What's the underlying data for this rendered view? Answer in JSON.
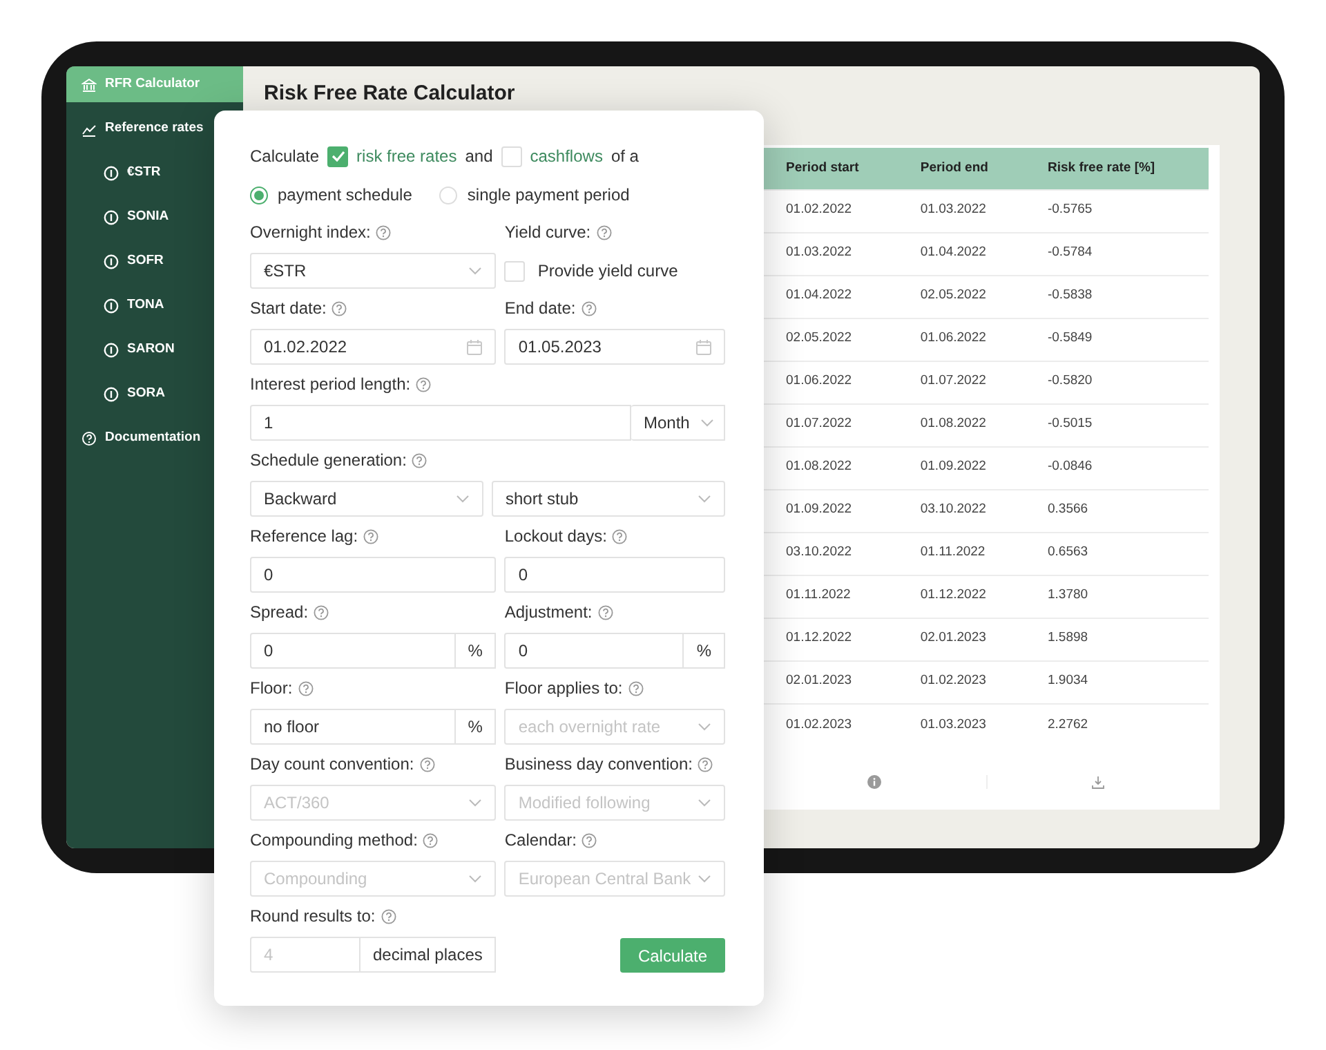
{
  "sidebar": {
    "items": [
      {
        "label": "RFR Calculator",
        "selected": true
      },
      {
        "label": "Reference rates",
        "selected": false,
        "children": [
          {
            "label": "€STR",
            "selected": false
          },
          {
            "label": "SONIA",
            "selected": false
          },
          {
            "label": "SOFR",
            "selected": false
          },
          {
            "label": "TONA",
            "selected": false
          },
          {
            "label": "SARON",
            "selected": false
          },
          {
            "label": "SORA",
            "selected": false
          }
        ]
      },
      {
        "label": "Documentation",
        "selected": false
      }
    ]
  },
  "title": "Risk Free Rate Calculator",
  "results": {
    "columns": [
      "Period start",
      "Period end",
      "Risk free rate [%]"
    ],
    "rows": [
      [
        "01.02.2022",
        "01.03.2022",
        "-0.5765"
      ],
      [
        "01.03.2022",
        "01.04.2022",
        "-0.5784"
      ],
      [
        "01.04.2022",
        "02.05.2022",
        "-0.5838"
      ],
      [
        "02.05.2022",
        "01.06.2022",
        "-0.5849"
      ],
      [
        "01.06.2022",
        "01.07.2022",
        "-0.5820"
      ],
      [
        "01.07.2022",
        "01.08.2022",
        "-0.5015"
      ],
      [
        "01.08.2022",
        "01.09.2022",
        "-0.0846"
      ],
      [
        "01.09.2022",
        "03.10.2022",
        "0.3566"
      ],
      [
        "03.10.2022",
        "01.11.2022",
        "0.6563"
      ],
      [
        "01.11.2022",
        "01.12.2022",
        "1.3780"
      ],
      [
        "01.12.2022",
        "02.01.2023",
        "1.5898"
      ],
      [
        "02.01.2023",
        "01.02.2023",
        "1.9034"
      ],
      [
        "01.02.2023",
        "01.03.2023",
        "2.2762"
      ]
    ]
  },
  "form": {
    "intro": [
      {
        "kind": "text",
        "text": "Calculate"
      },
      {
        "kind": "checkbox",
        "label": "risk free rates",
        "checked": true
      },
      {
        "kind": "text",
        "text": "and"
      },
      {
        "kind": "checkbox",
        "label": "cashflows",
        "checked": false
      },
      {
        "kind": "text",
        "text": "of a"
      }
    ],
    "schedule_type": [
      {
        "label": "payment schedule",
        "selected": true
      },
      {
        "label": "single payment period",
        "selected": false
      }
    ],
    "fields": [
      {
        "label": "Overnight index:",
        "kind": "select",
        "value": "€STR",
        "disabled": false
      },
      {
        "label": "Yield curve:",
        "kind": "checkbox",
        "text": "Provide yield curve",
        "checked": false
      },
      {
        "label": "Start date:",
        "kind": "date",
        "value": "01.02.2022"
      },
      {
        "label": "End date:",
        "kind": "date",
        "value": "01.05.2023"
      },
      {
        "label": "Interest period length:",
        "kind": "number_unit",
        "value": "1",
        "unit": "Month"
      },
      {
        "label": "Schedule generation:",
        "kind": "select_pair",
        "values": [
          "Backward",
          "short stub"
        ]
      },
      {
        "label": "Reference lag:",
        "kind": "text",
        "value": "0",
        "disabled": false
      },
      {
        "label": "Lockout days:",
        "kind": "text",
        "value": "0",
        "disabled": false
      },
      {
        "label": "Spread:",
        "kind": "addon",
        "value": "0",
        "addon": "%",
        "disabled": false
      },
      {
        "label": "Adjustment:",
        "kind": "addon",
        "value": "0",
        "addon": "%",
        "disabled": false
      },
      {
        "label": "Floor:",
        "kind": "addon",
        "value": "no floor",
        "addon": "%",
        "disabled": false
      },
      {
        "label": "Floor applies to:",
        "kind": "select",
        "value": "each overnight rate",
        "disabled": true
      },
      {
        "label": "Day count convention:",
        "kind": "select",
        "value": "ACT/360",
        "disabled": true
      },
      {
        "label": "Business day convention:",
        "kind": "select",
        "value": "Modified following",
        "disabled": true
      },
      {
        "label": "Compounding method:",
        "kind": "select",
        "value": "Compounding",
        "disabled": true
      },
      {
        "label": "Calendar:",
        "kind": "select",
        "value": "European Central Bank",
        "disabled": true
      },
      {
        "label": "Round results to:",
        "kind": "addon",
        "value": "4",
        "addon": "decimal places",
        "disabled": true
      }
    ],
    "submit": "Calculate"
  }
}
